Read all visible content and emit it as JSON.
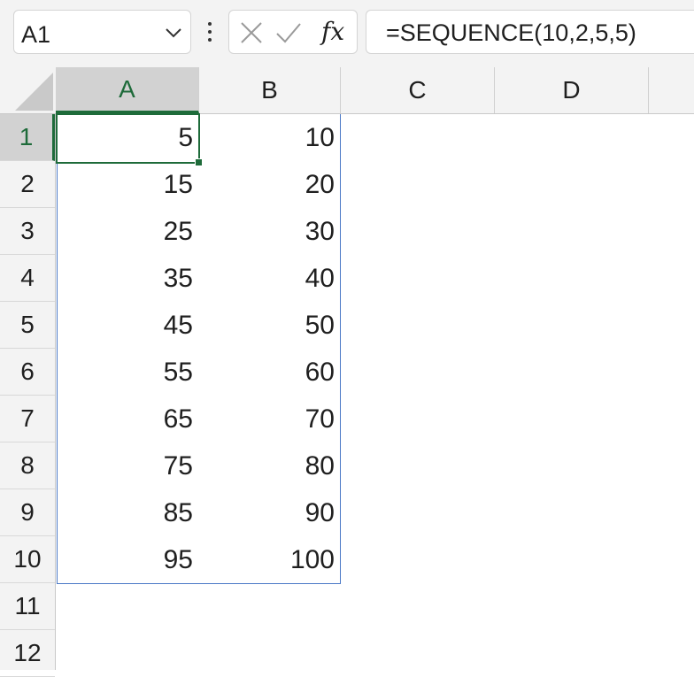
{
  "formula_bar": {
    "name_box": "A1",
    "name_box_icon": "chevron-down-icon",
    "more_icon": "vertical-ellipsis-icon",
    "cancel_icon": "close-icon",
    "enter_icon": "checkmark-icon",
    "fx_label": "fx",
    "formula": "=SEQUENCE(10,2,5,5)"
  },
  "columns": [
    "A",
    "B",
    "C",
    "D"
  ],
  "selected_column": "A",
  "rows": [
    "1",
    "2",
    "3",
    "4",
    "5",
    "6",
    "7",
    "8",
    "9",
    "10",
    "11",
    "12"
  ],
  "selected_row": "1",
  "cells": {
    "A": [
      "5",
      "15",
      "25",
      "35",
      "45",
      "55",
      "65",
      "75",
      "85",
      "95"
    ],
    "B": [
      "10",
      "20",
      "30",
      "40",
      "50",
      "60",
      "70",
      "80",
      "90",
      "100"
    ]
  },
  "colors": {
    "selection": "#1e6b3a",
    "spill_border": "#4a78c6",
    "header_background": "#f3f3f3"
  }
}
